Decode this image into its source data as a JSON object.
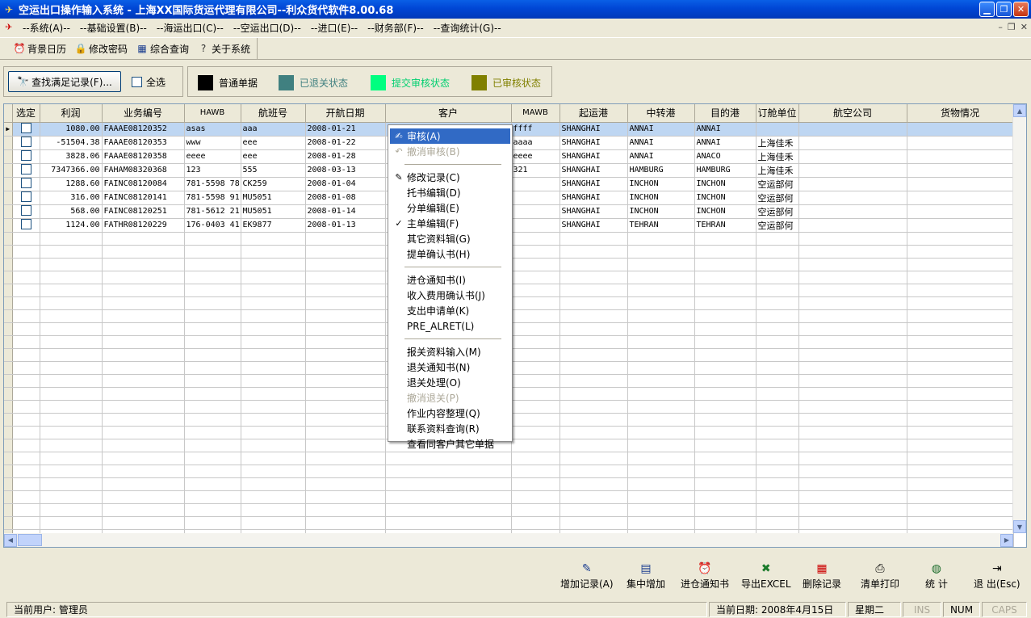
{
  "window": {
    "title": "空运出口操作输入系统 - 上海XX国际货运代理有限公司--利众货代软件8.00.68"
  },
  "menu": [
    "--系统(A)--",
    "--基础设置(B)--",
    "--海运出口(C)--",
    "--空运出口(D)--",
    "--进口(E)--",
    "--财务部(F)--",
    "--查询统计(G)--"
  ],
  "toolbar": {
    "calendar": "背景日历",
    "password": "修改密码",
    "query": "综合查询",
    "about": "关于系统"
  },
  "filter": {
    "find_button": "查找满足记录(F)...",
    "select_all": "全选"
  },
  "legend": [
    {
      "label": "普通单据",
      "color": "#000000",
      "text_color": "#000000"
    },
    {
      "label": "已退关状态",
      "color": "#408080",
      "text_color": "#408080"
    },
    {
      "label": "提交审核状态",
      "color": "#00FF80",
      "text_color": "#00D070"
    },
    {
      "label": "已审核状态",
      "color": "#808000",
      "text_color": "#808000"
    }
  ],
  "grid": {
    "columns": [
      "选定",
      "利润",
      "业务编号",
      "HAWB",
      "航班号",
      "开航日期",
      "客户",
      "MAWB",
      "起运港",
      "中转港",
      "目的港",
      "订舱单位",
      "航空公司",
      "货物情况"
    ],
    "rows": [
      [
        "",
        "1080.00",
        "FAAAE08120352",
        "asas",
        "aaa",
        "2008-01-21",
        "",
        "ffff",
        "SHANGHAI",
        "ANNAI",
        "ANNAI",
        "",
        "",
        ""
      ],
      [
        "",
        "-51504.38",
        "FAAAE08120353",
        "www",
        "eee",
        "2008-01-22",
        "",
        "aaaa",
        "SHANGHAI",
        "ANNAI",
        "ANNAI",
        "上海佳禾",
        "",
        ""
      ],
      [
        "",
        "3828.06",
        "FAAAE08120358",
        "eeee",
        "eee",
        "2008-01-28",
        "",
        "eeee",
        "SHANGHAI",
        "ANNAI",
        "ANACO",
        "上海佳禾",
        "",
        ""
      ],
      [
        "",
        "7347366.00",
        "FAHAM08320368",
        "123",
        "555",
        "2008-03-13",
        "",
        "321",
        "SHANGHAI",
        "HAMBURG",
        "HAMBURG",
        "上海佳禾",
        "",
        ""
      ],
      [
        "",
        "1288.60",
        "FAINC08120084",
        "781-5598 78",
        "CK259",
        "2008-01-04",
        "",
        "",
        "SHANGHAI",
        "INCHON",
        "INCHON",
        "空运部何",
        "",
        ""
      ],
      [
        "",
        "316.00",
        "FAINC08120141",
        "781-5598 91",
        "MU5051",
        "2008-01-08",
        "",
        "",
        "SHANGHAI",
        "INCHON",
        "INCHON",
        "空运部何",
        "",
        ""
      ],
      [
        "",
        "568.00",
        "FAINC08120251",
        "781-5612 21",
        "MU5051",
        "2008-01-14",
        "",
        "",
        "SHANGHAI",
        "INCHON",
        "INCHON",
        "空运部何",
        "",
        ""
      ],
      [
        "",
        "1124.00",
        "FATHR08120229",
        "176-0403 41",
        "EK9877",
        "2008-01-13",
        "",
        "",
        "SHANGHAI",
        "TEHRAN",
        "TEHRAN",
        "空运部何",
        "",
        ""
      ]
    ],
    "empty_rows": 25
  },
  "context_menu": [
    {
      "label": "审核(A)",
      "icon": "audit-icon",
      "state": "highlight"
    },
    {
      "label": "撤消审核(B)",
      "icon": "undo-icon",
      "state": "disabled"
    },
    {
      "sep": true
    },
    {
      "label": "修改记录(C)",
      "icon": "edit-record-icon",
      "state": "normal"
    },
    {
      "label": "托书编辑(D)",
      "state": "normal"
    },
    {
      "label": "分单编辑(E)",
      "state": "normal"
    },
    {
      "label": "主单编辑(F)",
      "icon": "master-bill-icon",
      "state": "normal"
    },
    {
      "label": "其它资料辑(G)",
      "state": "normal"
    },
    {
      "label": "提单确认书(H)",
      "state": "normal"
    },
    {
      "sep": true
    },
    {
      "label": "进仓通知书(I)",
      "state": "normal"
    },
    {
      "label": "收入费用确认书(J)",
      "state": "normal"
    },
    {
      "label": "支出申请单(K)",
      "state": "normal"
    },
    {
      "label": "PRE_ALRET(L)",
      "state": "normal"
    },
    {
      "sep": true
    },
    {
      "label": "报关资料输入(M)",
      "state": "normal"
    },
    {
      "label": "退关通知书(N)",
      "state": "normal"
    },
    {
      "label": "退关处理(O)",
      "state": "normal"
    },
    {
      "label": "撤消退关(P)",
      "state": "disabled"
    },
    {
      "label": "作业内容整理(Q)",
      "state": "normal"
    },
    {
      "label": "联系资料查询(R)",
      "state": "normal"
    },
    {
      "label": "查看同客户其它单据",
      "state": "normal"
    }
  ],
  "bottom_toolbar": [
    {
      "label": "增加记录(A)",
      "icon": "add-record-icon"
    },
    {
      "label": "集中增加",
      "icon": "batch-add-icon"
    },
    {
      "label": "进仓通知书",
      "icon": "clock-icon"
    },
    {
      "label": "导出EXCEL",
      "icon": "excel-icon"
    },
    {
      "label": "删除记录",
      "icon": "delete-icon"
    },
    {
      "label": "清单打印",
      "icon": "printer-icon"
    },
    {
      "label": "统 计",
      "icon": "globe-icon"
    },
    {
      "label": "退 出(Esc)",
      "icon": "exit-icon"
    }
  ],
  "status": {
    "user": "当前用户: 管理员",
    "date": "当前日期: 2008年4月15日",
    "weekday": "星期二",
    "ins": "INS",
    "num": "NUM",
    "caps": "CAPS"
  }
}
